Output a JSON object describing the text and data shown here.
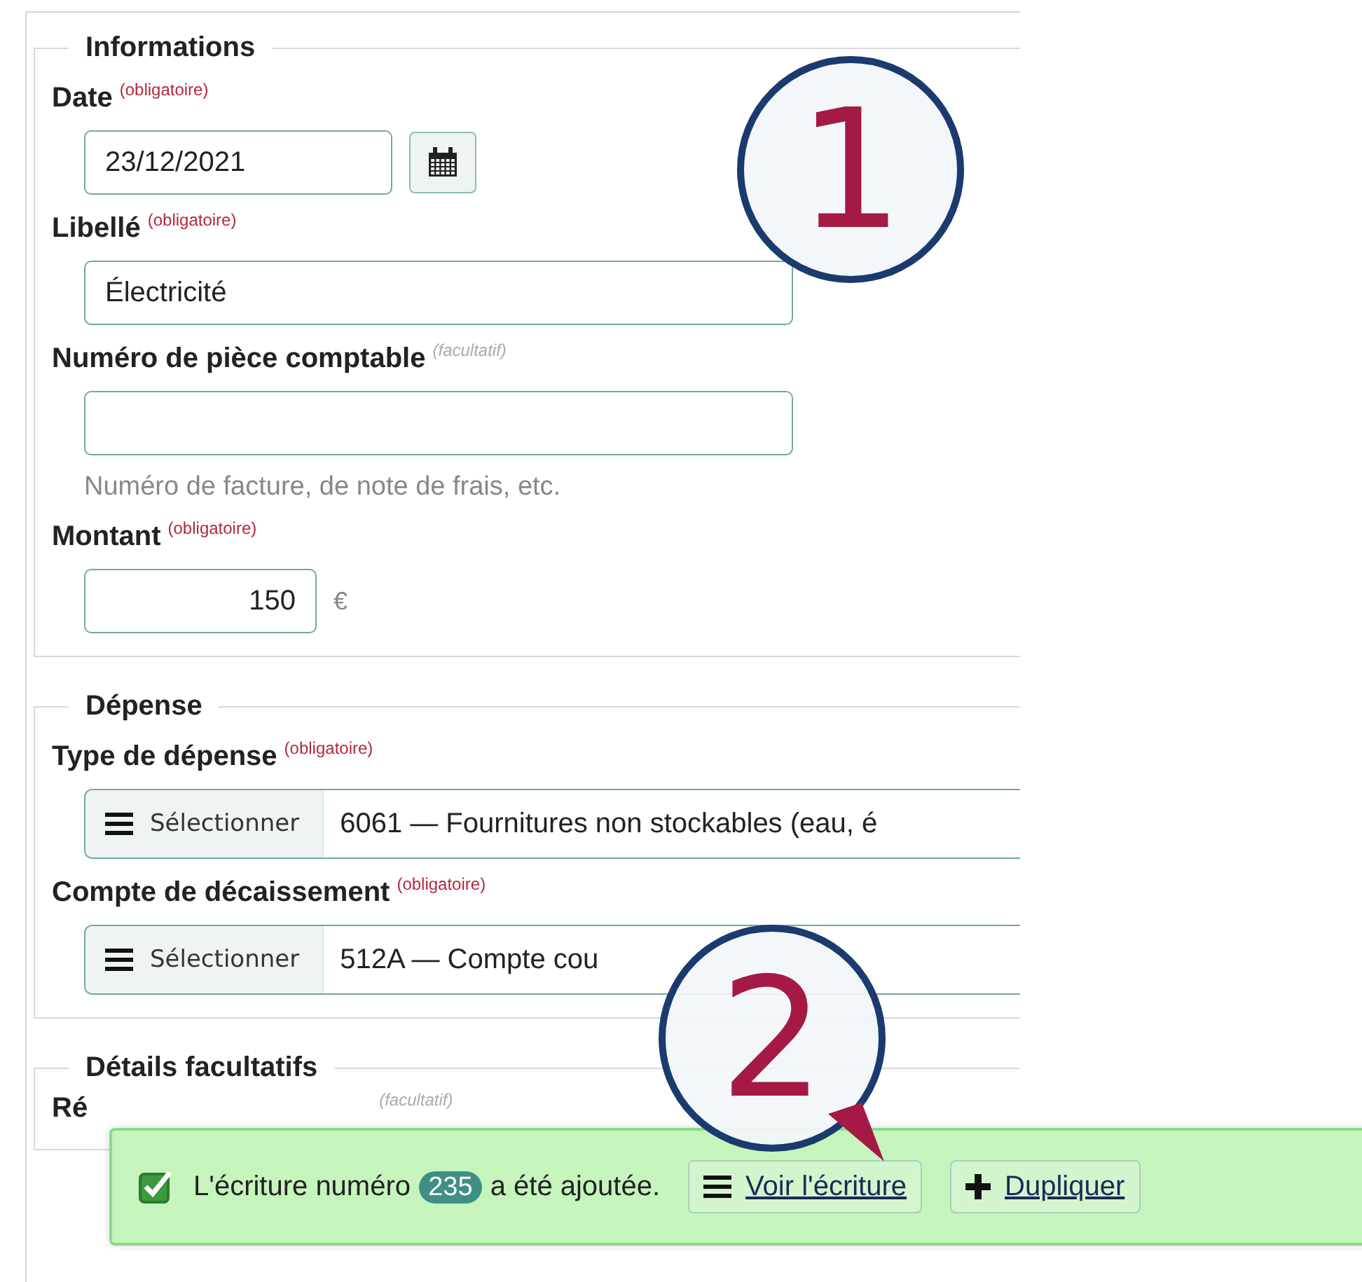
{
  "sections": [
    {
      "legend": "Informations",
      "fields": [
        {
          "kind": "date",
          "label": "Date",
          "requirement": "(obligatoire)",
          "required": true,
          "value": "23/12/2021"
        },
        {
          "kind": "text",
          "label": "Libellé",
          "requirement": "(obligatoire)",
          "required": true,
          "value": "Électricité"
        },
        {
          "kind": "text",
          "label": "Numéro de pièce comptable",
          "requirement": "(facultatif)",
          "required": false,
          "help": "Numéro de facture, de note de frais, etc."
        },
        {
          "kind": "amount",
          "label": "Montant",
          "requirement": "(obligatoire)",
          "required": true,
          "value": "150",
          "unit": "€"
        }
      ]
    },
    {
      "legend": "Dépense",
      "fields": [
        {
          "kind": "select",
          "label": "Type de dépense",
          "requirement": "(obligatoire)",
          "required": true,
          "button": "Sélectionner",
          "value": "6061 — Fournitures non stockables (eau, é"
        },
        {
          "kind": "select",
          "label": "Compte de décaissement",
          "requirement": "(obligatoire)",
          "required": true,
          "button": "Sélectionner",
          "value": "512A — Compte cou"
        }
      ]
    },
    {
      "legend": "Détails facultatifs",
      "fields": [
        {
          "kind": "label",
          "label": "Ré",
          "requirement": "(facultatif)",
          "required": false
        }
      ]
    }
  ],
  "toast": {
    "checked": true,
    "message_before": "L'écriture numéro",
    "number": "235",
    "message_after": "a été ajoutée.",
    "actions": [
      {
        "label": "Voir l'écriture",
        "kind": "view"
      },
      {
        "label": "Dupliquer",
        "kind": "duplicate"
      }
    ]
  },
  "callouts": [
    {
      "number": "1"
    },
    {
      "number": "2"
    }
  ]
}
